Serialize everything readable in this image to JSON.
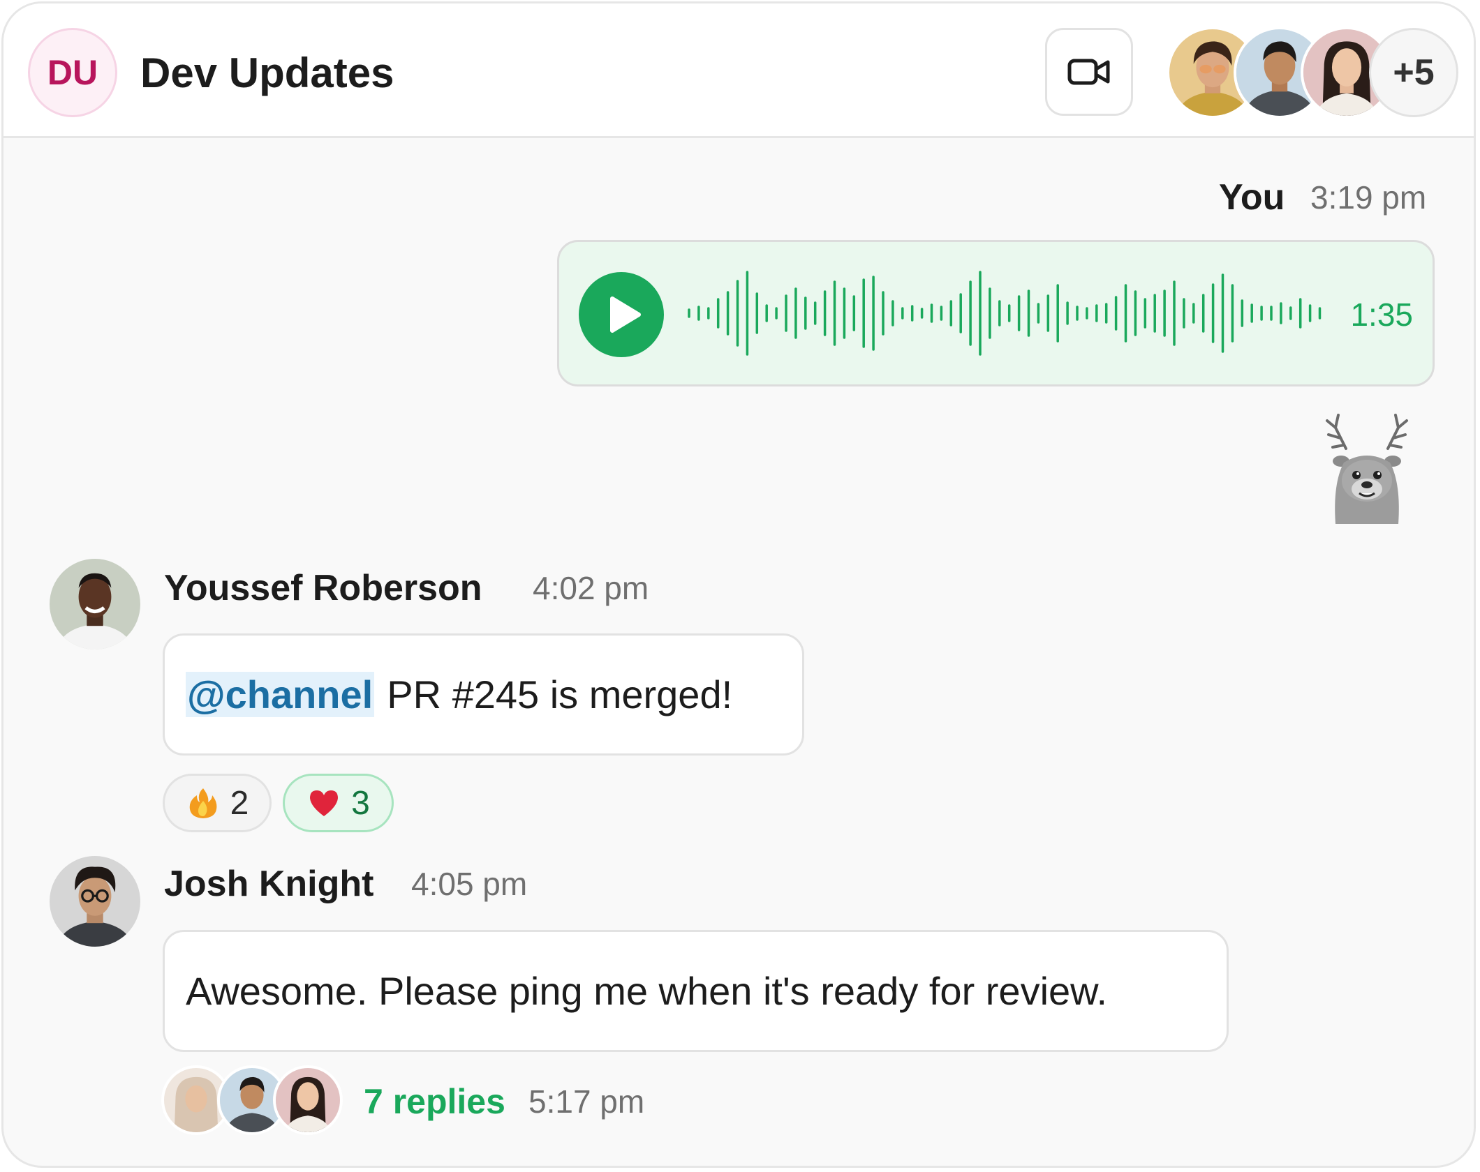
{
  "header": {
    "badge": "DU",
    "title": "Dev Updates",
    "video_icon": "video-camera-icon",
    "extra_members": "+5"
  },
  "messages": [
    {
      "sender": "You",
      "time": "3:19 pm",
      "type": "voice",
      "duration": "1:35",
      "sticker": "reindeer-sticker"
    },
    {
      "sender": "Youssef Roberson",
      "time": "4:02 pm",
      "mention": "@channel",
      "text": "PR #245 is merged!",
      "reactions": [
        {
          "emoji": "fire-emoji",
          "count": "2"
        },
        {
          "emoji": "heart-emoji",
          "count": "3"
        }
      ]
    },
    {
      "sender": "Josh Knight",
      "time": "4:05 pm",
      "text": "Awesome. Please ping me when it's ready for review.",
      "thread": {
        "replies": "7 replies",
        "last_reply_time": "5:17 pm"
      }
    }
  ],
  "colors": {
    "accent_green": "#1aa85b",
    "mention_blue": "#1b6ea3",
    "badge_pink": "#b8155c"
  }
}
